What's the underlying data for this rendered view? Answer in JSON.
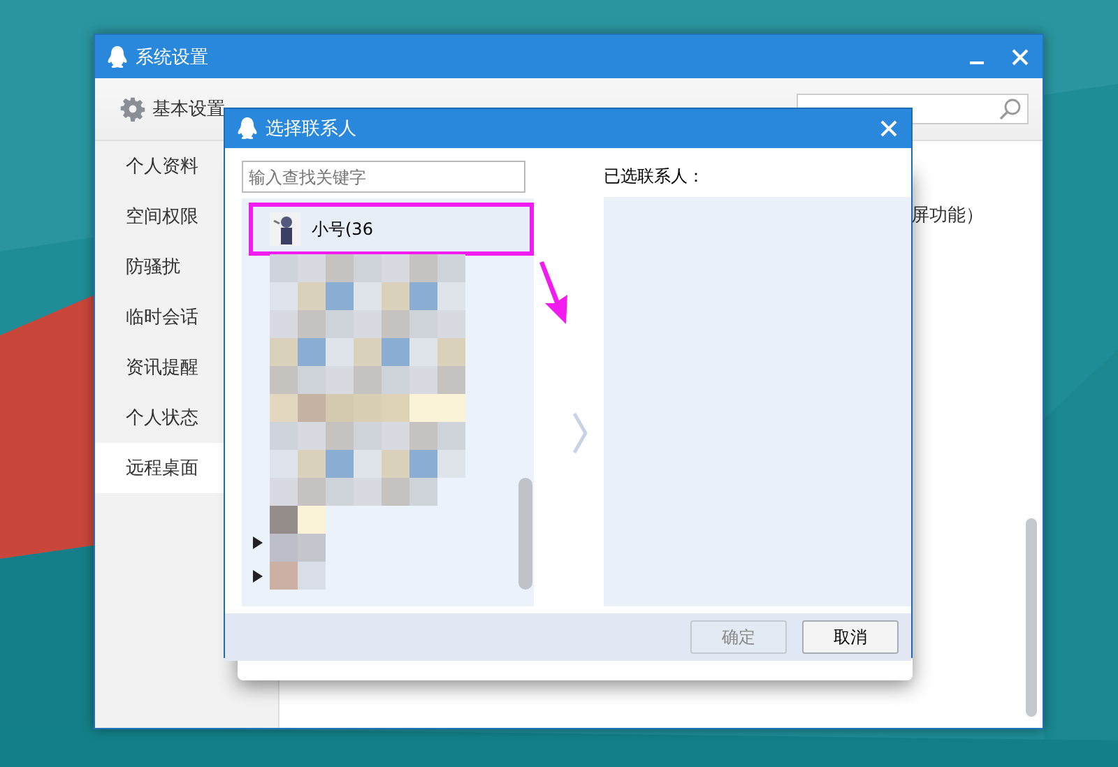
{
  "main_window": {
    "title": "系统设置",
    "toolbar_tabs": [
      {
        "label": "基本设置",
        "selected": false
      }
    ],
    "sidebar": {
      "items": [
        {
          "label": "个人资料",
          "selected": false
        },
        {
          "label": "空间权限",
          "selected": false
        },
        {
          "label": "防骚扰",
          "selected": false
        },
        {
          "label": "临时会话",
          "selected": false
        },
        {
          "label": "资讯提醒",
          "selected": false
        },
        {
          "label": "个人状态",
          "selected": false
        },
        {
          "label": "远程桌面",
          "selected": true
        }
      ]
    },
    "content_text": "屏功能）"
  },
  "dialog": {
    "title": "选择联系人",
    "search": {
      "placeholder": "输入查找关键字"
    },
    "contacts": [
      {
        "name": "小号(36",
        "selected": true
      }
    ],
    "groups": [
      {
        "expanded": false
      },
      {
        "expanded": false
      }
    ],
    "selected_label": "已选联系人：",
    "buttons": [
      {
        "label": "确定",
        "disabled": true
      },
      {
        "label": "取消",
        "disabled": false
      }
    ]
  }
}
